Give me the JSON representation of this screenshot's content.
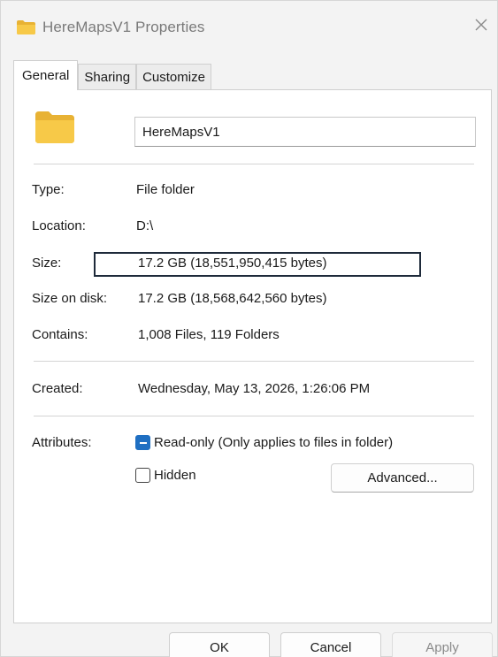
{
  "window": {
    "title": "HereMapsV1 Properties",
    "title_icon": "folder-icon",
    "close_icon": "close-icon"
  },
  "tabs": [
    {
      "label": "General",
      "active": true
    },
    {
      "label": "Sharing",
      "active": false
    },
    {
      "label": "Customize",
      "active": false
    }
  ],
  "general": {
    "folder_icon": "folder-icon",
    "name_value": "HereMapsV1",
    "type": {
      "label": "Type:",
      "value": "File folder"
    },
    "location": {
      "label": "Location:",
      "value": "D:\\"
    },
    "size": {
      "label": "Size:",
      "value": "17.2 GB (18,551,950,415 bytes)"
    },
    "size_on_disk": {
      "label": "Size on disk:",
      "value": "17.2 GB (18,568,642,560 bytes)"
    },
    "contains": {
      "label": "Contains:",
      "value": "1,008 Files, 119 Folders"
    },
    "created": {
      "label": "Created:",
      "value": "Wednesday, May 13, 2026, 1:26:06 PM"
    },
    "attributes": {
      "label": "Attributes:",
      "readonly_label": "Read-only (Only applies to files in folder)",
      "readonly_state": "indeterminate",
      "hidden_label": "Hidden",
      "hidden_state": "unchecked",
      "advanced_label": "Advanced..."
    }
  },
  "footer": {
    "ok_label": "OK",
    "cancel_label": "Cancel",
    "apply_label": "Apply"
  },
  "colors": {
    "accent": "#1f6fc2",
    "folder_yellow": "#f7c948",
    "highlight_border": "#1e2a3a"
  }
}
